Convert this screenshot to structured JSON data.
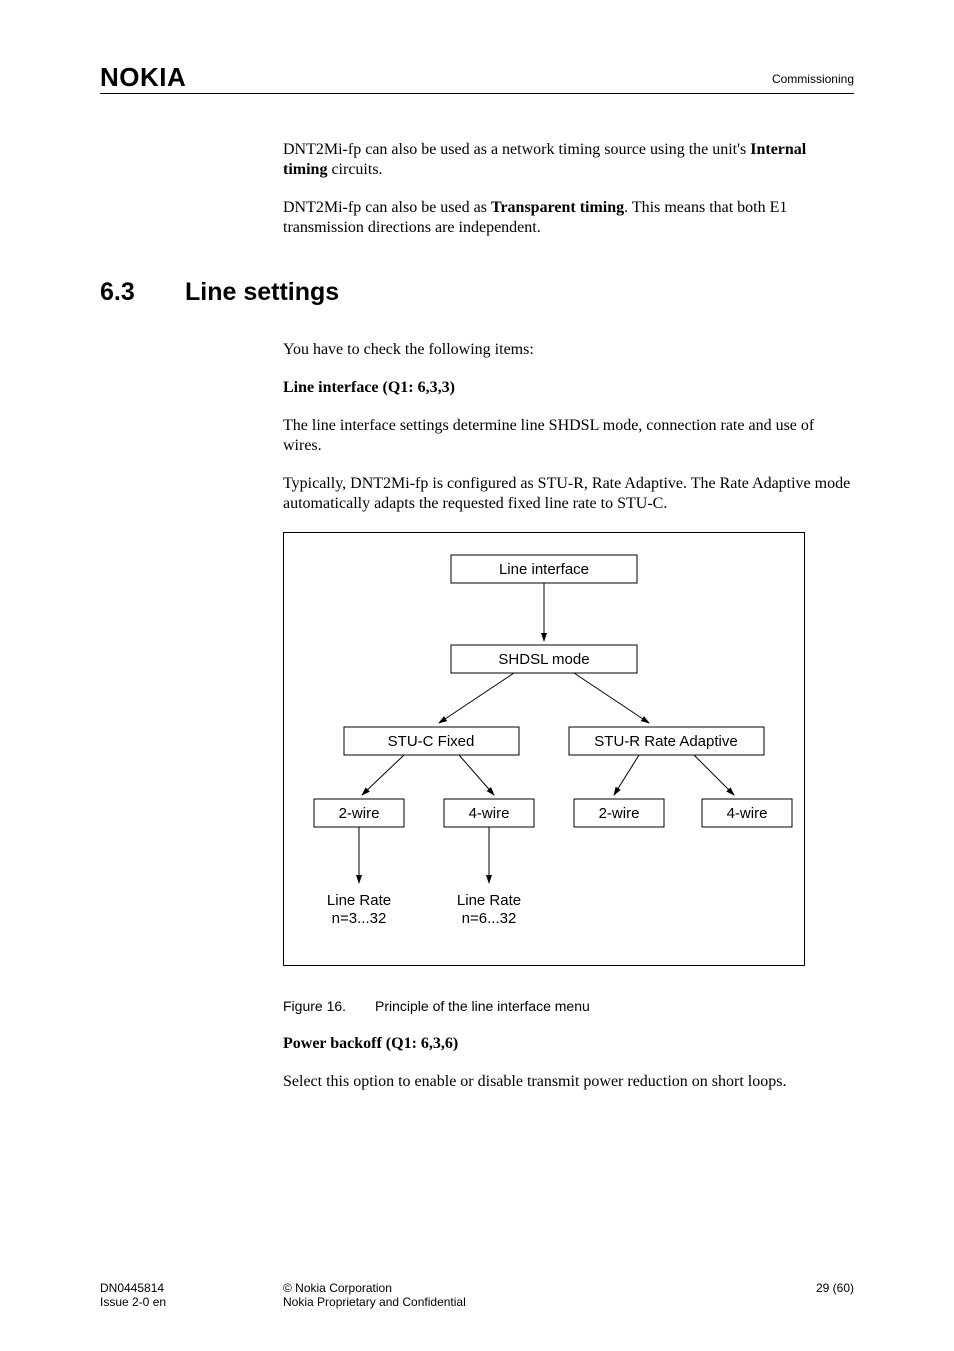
{
  "header": {
    "logo": "NOKIA",
    "section": "Commissioning"
  },
  "intro": {
    "p1_prefix": "DNT2Mi-fp can also be used as a network timing source using the unit's ",
    "p1_bold": "Internal timing",
    "p1_suffix": " circuits.",
    "p2_prefix": "DNT2Mi-fp can also be used as ",
    "p2_bold": "Transparent timing",
    "p2_suffix": ". This means that both E1 transmission directions are independent."
  },
  "section": {
    "num": "6.3",
    "title": "Line settings",
    "p1": "You have to check the following items:",
    "h1": "Line interface (Q1: 6,3,3)",
    "p2": "The line interface settings determine line SHDSL mode, connection rate and use of wires.",
    "p3": "Typically, DNT2Mi-fp is configured as STU-R, Rate Adaptive. The Rate Adaptive mode automatically adapts the requested fixed line rate to STU-C.",
    "fig": {
      "line_interface": "Line interface",
      "shdsl_mode": "SHDSL mode",
      "stuc": "STU-C Fixed",
      "stur": "STU-R Rate Adaptive",
      "w2": "2-wire",
      "w4": "4-wire",
      "rate1a": "Line Rate",
      "rate1b": "n=3...32",
      "rate2a": "Line Rate",
      "rate2b": "n=6...32"
    },
    "fig_caption_num": "Figure 16.",
    "fig_caption_text": "Principle of the line interface menu",
    "h2": "Power backoff (Q1: 6,3,6)",
    "p4": "Select this option to enable or disable transmit power reduction on short loops."
  },
  "footer": {
    "doc": "DN0445814",
    "issue": "Issue 2-0 en",
    "copyright": "© Nokia Corporation",
    "conf": "Nokia Proprietary and Confidential",
    "page": "29 (60)"
  }
}
